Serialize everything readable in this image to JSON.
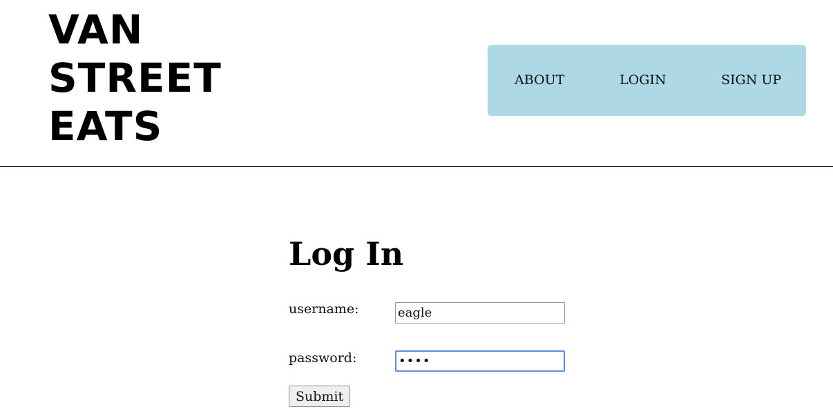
{
  "site": {
    "logo_lines": [
      "VAN",
      "STREET",
      "EATS"
    ]
  },
  "nav": {
    "about": "ABOUT",
    "login": "LOGIN",
    "signup": "SIGN UP"
  },
  "login_form": {
    "title": "Log In",
    "username_label": "username:",
    "username_value": "eagle",
    "password_label": "password:",
    "password_value": "eagl",
    "submit_label": "Submit"
  },
  "colors": {
    "nav_background": "#add8e6",
    "focused_input_border": "#5b8fd9"
  }
}
